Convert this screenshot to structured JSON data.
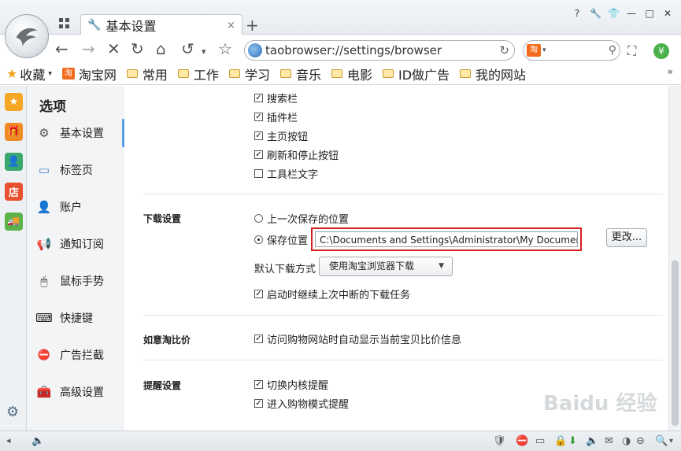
{
  "window": {
    "tab_title": "基本设置",
    "tab_close": "×",
    "new_tab": "+",
    "controls": [
      "?",
      "🔧",
      "👕",
      "—",
      "□",
      "✕"
    ]
  },
  "nav": {
    "back": "←",
    "forward": "→",
    "stop": "✕",
    "refresh": "↻",
    "home": "⌂",
    "undo": "↺",
    "undo_caret": "▾",
    "bookmark_star": "☆",
    "url": "taobrowser://settings/browser",
    "addr_reload": "↻",
    "search_engine": "淘",
    "search_caret": "▾",
    "search_icon": "⚲",
    "screenshot": "⛶",
    "yen": "¥"
  },
  "bookmarks": {
    "favorites": "收藏",
    "favorites_caret": "▾",
    "items": [
      "淘宝网",
      "常用",
      "工作",
      "学习",
      "音乐",
      "电影",
      "ID做广告",
      "我的网站"
    ],
    "more": "»"
  },
  "sidebar_apps": [
    "star-app",
    "gift-app",
    "contacts-app",
    "shop-app",
    "cart-app"
  ],
  "sidebar_app_labels": {
    "star": "★",
    "gift": "🎁",
    "contacts": "👤",
    "shop": "店",
    "cart": "🚚"
  },
  "menu": {
    "title": "选项",
    "items": [
      {
        "label": "基本设置",
        "icon": "gear-icon",
        "glyph": "⚙"
      },
      {
        "label": "标签页",
        "icon": "tab-icon",
        "glyph": "▭"
      },
      {
        "label": "账户",
        "icon": "user-icon",
        "glyph": "👤"
      },
      {
        "label": "通知订阅",
        "icon": "megaphone-icon",
        "glyph": "📢"
      },
      {
        "label": "鼠标手势",
        "icon": "mouse-icon",
        "glyph": "🖱"
      },
      {
        "label": "快捷键",
        "icon": "keyboard-icon",
        "glyph": "⌨"
      },
      {
        "label": "广告拦截",
        "icon": "block-icon",
        "glyph": "⛔"
      },
      {
        "label": "高级设置",
        "icon": "toolbox-icon",
        "glyph": "🧰"
      }
    ],
    "bottom_gear": "⚙"
  },
  "toolbar_options": [
    {
      "label": "搜索栏",
      "checked": true
    },
    {
      "label": "插件栏",
      "checked": true
    },
    {
      "label": "主页按钮",
      "checked": true
    },
    {
      "label": "刷新和停止按钮",
      "checked": true
    },
    {
      "label": "工具栏文字",
      "checked": false
    }
  ],
  "download": {
    "section": "下载设置",
    "last_location": "上一次保存的位置",
    "save_location": "保存位置",
    "path": "C:\\Documents and Settings\\Administrator\\My Documents",
    "change_button": "更改...",
    "default_method_label": "默认下载方式",
    "default_method_value": "使用淘宝浏览器下载",
    "select_arrow": "▼",
    "resume_label": "启动时继续上次中断的下载任务",
    "resume_checked": true
  },
  "compare": {
    "section": "如意淘比价",
    "label": "访问购物网站时自动显示当前宝贝比价信息",
    "checked": true
  },
  "reminder": {
    "section": "提醒设置",
    "items": [
      {
        "label": "切换内核提醒",
        "checked": true
      },
      {
        "label": "进入购物模式提醒",
        "checked": true
      }
    ]
  },
  "check_mark": "☑",
  "tick": "✓",
  "watermark": "Baidu 经验",
  "status": {
    "left_icons": [
      "◂",
      "🔈"
    ],
    "right_icons": [
      "🛡",
      "⛔",
      "▭",
      "🔒",
      "⬇",
      "🔈",
      "✉",
      "◑",
      "⊖",
      "🔍",
      "▾"
    ]
  }
}
